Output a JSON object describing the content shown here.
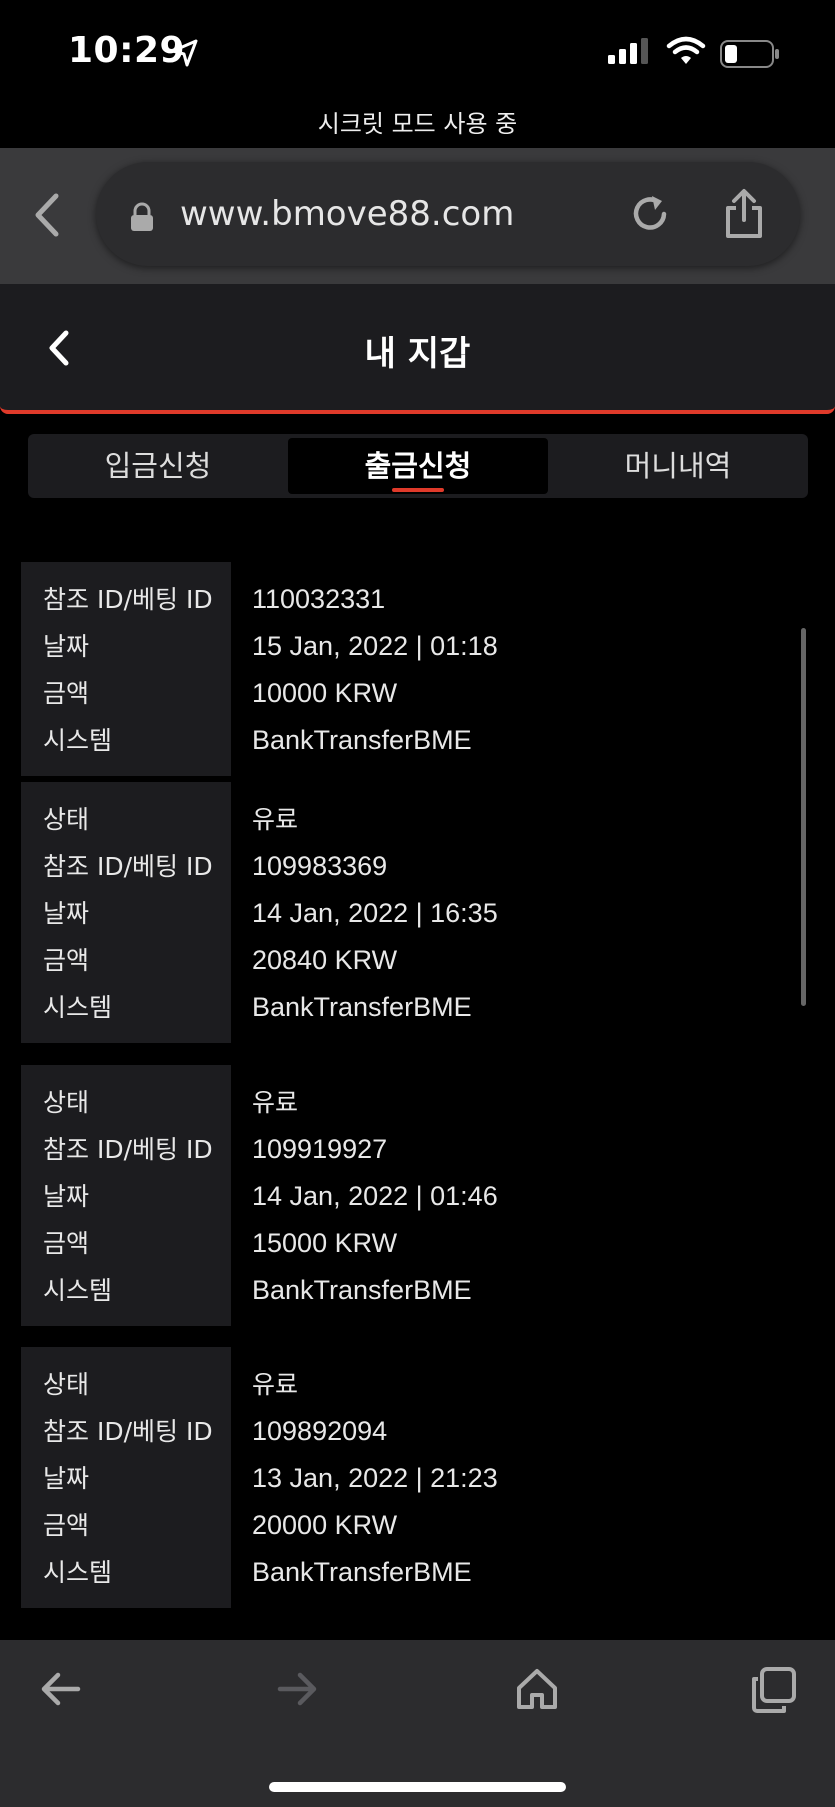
{
  "status_bar": {
    "time": "10:29",
    "private_mode": "시크릿 모드 사용 중"
  },
  "browser": {
    "url": "www.bmove88.com"
  },
  "header": {
    "title": "내 지갑"
  },
  "tabs": [
    {
      "label": "입금신청",
      "active": false
    },
    {
      "label": "출금신청",
      "active": true
    },
    {
      "label": "머니내역",
      "active": false
    }
  ],
  "labels": {
    "status": "상태",
    "ref_id": "참조 ID/베팅 ID",
    "date": "날짜",
    "amount": "금액",
    "system": "시스템"
  },
  "records": [
    {
      "ref_id": "110032331",
      "date": "15 Jan, 2022 | 01:18",
      "amount": "10000 KRW",
      "system": "BankTransferBME"
    },
    {
      "status": "유료",
      "ref_id": "109983369",
      "date": "14 Jan, 2022 | 16:35",
      "amount": "20840 KRW",
      "system": "BankTransferBME"
    },
    {
      "status": "유료",
      "ref_id": "109919927",
      "date": "14 Jan, 2022 | 01:46",
      "amount": "15000 KRW",
      "system": "BankTransferBME"
    },
    {
      "status": "유료",
      "ref_id": "109892094",
      "date": "13 Jan, 2022 | 21:23",
      "amount": "20000 KRW",
      "system": "BankTransferBME"
    }
  ],
  "colors": {
    "accent": "#e03a2a",
    "panel": "#1c1c1f",
    "background": "#000000"
  }
}
